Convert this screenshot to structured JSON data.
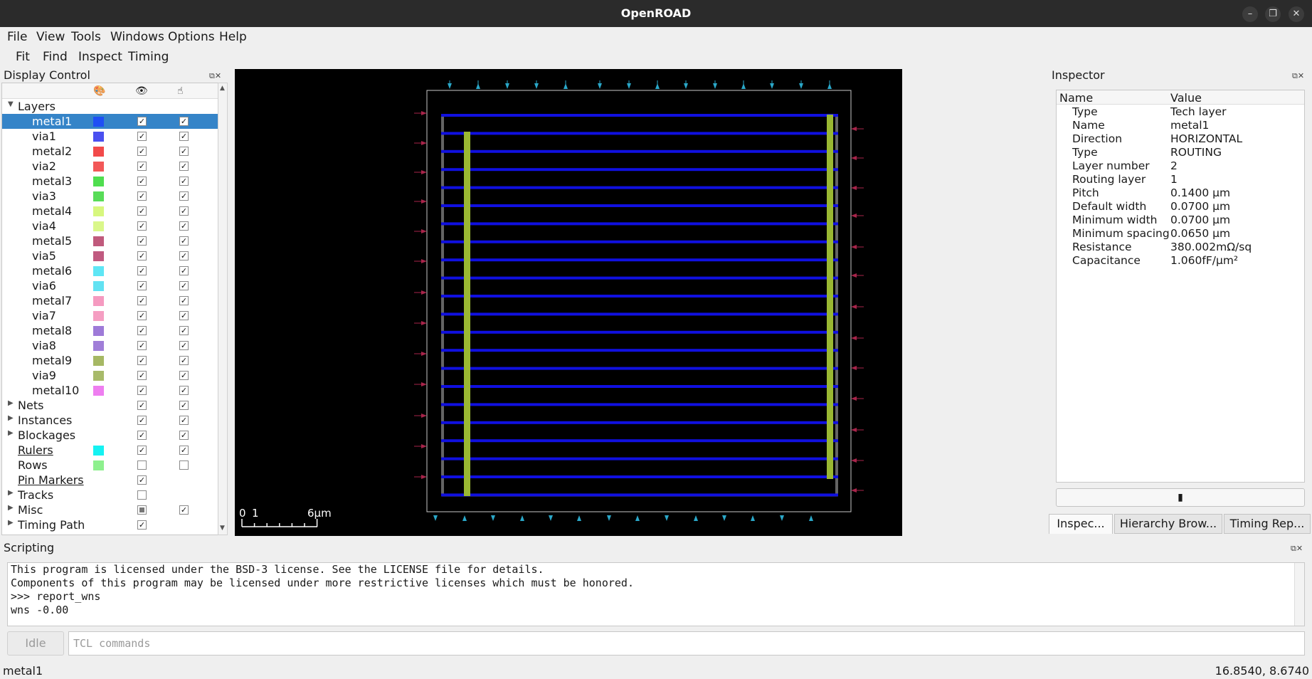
{
  "window": {
    "title": "OpenROAD"
  },
  "menubar": [
    "File",
    "View",
    "Tools",
    "Windows",
    "Options",
    "Help"
  ],
  "toolbar": [
    "Fit",
    "Find",
    "Inspect",
    "Timing"
  ],
  "display_control": {
    "title": "Display Control",
    "columns": {
      "color": "palette-icon",
      "visible": "eye-icon",
      "selectable": "pointer-hand-icon"
    },
    "layers_label": "Layers",
    "layers": [
      {
        "name": "metal1",
        "color": "#1f4ff5",
        "visible": true,
        "selectable": true,
        "selected": true
      },
      {
        "name": "via1",
        "color": "#4a50f0",
        "visible": true,
        "selectable": true
      },
      {
        "name": "metal2",
        "color": "#f24a4a",
        "visible": true,
        "selectable": true
      },
      {
        "name": "via2",
        "color": "#f25858",
        "visible": true,
        "selectable": true
      },
      {
        "name": "metal3",
        "color": "#4fde4f",
        "visible": true,
        "selectable": true
      },
      {
        "name": "via3",
        "color": "#58dc58",
        "visible": true,
        "selectable": true
      },
      {
        "name": "metal4",
        "color": "#d7f77e",
        "visible": true,
        "selectable": true
      },
      {
        "name": "via4",
        "color": "#daf78a",
        "visible": true,
        "selectable": true
      },
      {
        "name": "metal5",
        "color": "#c05a7c",
        "visible": true,
        "selectable": true
      },
      {
        "name": "via5",
        "color": "#c05a80",
        "visible": true,
        "selectable": true
      },
      {
        "name": "metal6",
        "color": "#5ee6f5",
        "visible": true,
        "selectable": true
      },
      {
        "name": "via6",
        "color": "#62e2f2",
        "visible": true,
        "selectable": true
      },
      {
        "name": "metal7",
        "color": "#f59ac0",
        "visible": true,
        "selectable": true
      },
      {
        "name": "via7",
        "color": "#f59ec2",
        "visible": true,
        "selectable": true
      },
      {
        "name": "metal8",
        "color": "#9e7ad8",
        "visible": true,
        "selectable": true
      },
      {
        "name": "via8",
        "color": "#a07ed8",
        "visible": true,
        "selectable": true
      },
      {
        "name": "metal9",
        "color": "#a6b864",
        "visible": true,
        "selectable": true
      },
      {
        "name": "via9",
        "color": "#a8ba6a",
        "visible": true,
        "selectable": true
      },
      {
        "name": "metal10",
        "color": "#ee7ef0",
        "visible": true,
        "selectable": true
      }
    ],
    "groups": [
      {
        "name": "Nets",
        "expandable": true,
        "visible": "checked",
        "selectable": "checked"
      },
      {
        "name": "Instances",
        "expandable": true,
        "visible": "checked",
        "selectable": "checked"
      },
      {
        "name": "Blockages",
        "expandable": true,
        "visible": "checked",
        "selectable": "checked"
      },
      {
        "name": "Rulers",
        "link": true,
        "color": "#15f2f2",
        "visible": "checked",
        "selectable": "checked"
      },
      {
        "name": "Rows",
        "color": "#8ef08e",
        "visible": "unchecked",
        "selectable": "unchecked"
      },
      {
        "name": "Pin Markers",
        "link": true,
        "visible": "checked"
      },
      {
        "name": "Tracks",
        "expandable": true,
        "visible": "unchecked"
      },
      {
        "name": "Misc",
        "expandable": true,
        "visible": "partial",
        "selectable": "checked"
      },
      {
        "name": "Timing Path",
        "expandable": true,
        "visible": "checked"
      }
    ]
  },
  "layout_view": {
    "scale_bar": {
      "label_0": "0",
      "label_1": "1",
      "label_end": "6μm"
    },
    "colors": {
      "metal1": "#1010e0",
      "stripe": "#9ab832",
      "pin": "#2aa7c8",
      "io_pin": "#a8244a",
      "outline": "#c8c8c8"
    }
  },
  "inspector": {
    "title": "Inspector",
    "col_name": "Name",
    "col_value": "Value",
    "rows": [
      {
        "k": "Type",
        "v": "Tech layer"
      },
      {
        "k": "Name",
        "v": "metal1"
      },
      {
        "k": "Direction",
        "v": "HORIZONTAL"
      },
      {
        "k": "Type",
        "v": "ROUTING"
      },
      {
        "k": "Layer number",
        "v": "2"
      },
      {
        "k": "Routing layer",
        "v": "1"
      },
      {
        "k": "Pitch",
        "v": "0.1400 μm"
      },
      {
        "k": "Default width",
        "v": "0.0700 μm"
      },
      {
        "k": "Minimum width",
        "v": "0.0700 μm"
      },
      {
        "k": "Minimum spacing",
        "v": "0.0650 μm"
      },
      {
        "k": "Resistance",
        "v": "380.002mΩ/sq"
      },
      {
        "k": "Capacitance",
        "v": "1.060fF/μm²"
      }
    ],
    "button_icon": "highlight-icon",
    "tabs": [
      "Inspec...",
      "Hierarchy Brow...",
      "Timing Rep..."
    ]
  },
  "scripting": {
    "title": "Scripting",
    "output": [
      "This program is licensed under the BSD-3 license. See the LICENSE file for details.",
      "Components of this program may be licensed under more restrictive licenses which must be honored.",
      ">>> report_wns",
      "wns -0.00"
    ],
    "idle_label": "Idle",
    "input_placeholder": "TCL commands"
  },
  "status": {
    "left": "metal1",
    "right": "16.8540, 8.6740"
  }
}
